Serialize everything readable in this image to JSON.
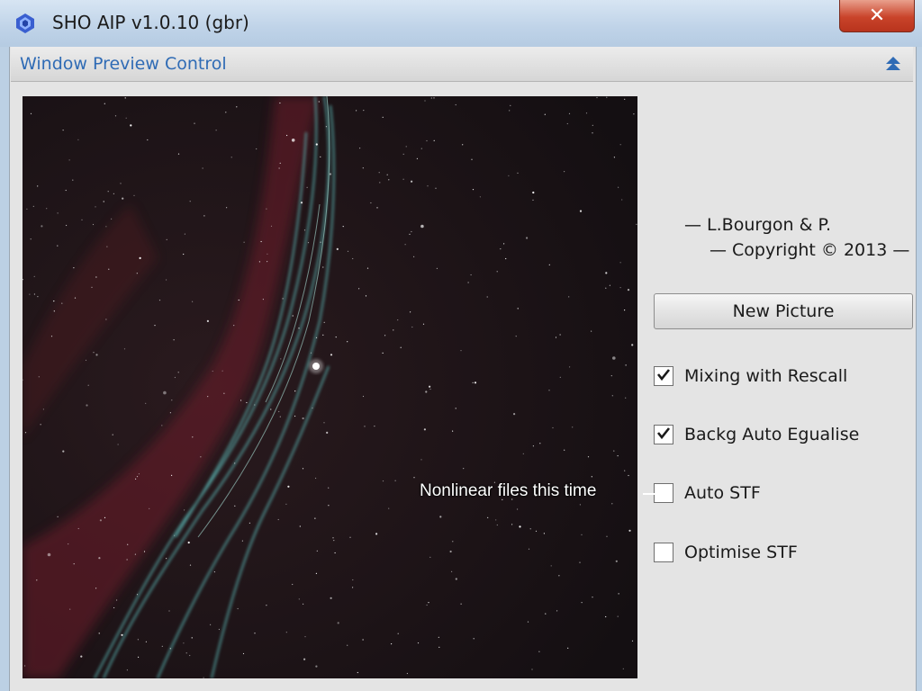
{
  "window": {
    "title": "SHO AIP v1.0.10 (gbr)",
    "close_label": "✕"
  },
  "section": {
    "title": "Window Preview Control"
  },
  "credits": {
    "line1": "— L.Bourgon & P.",
    "line2": "— Copyright © 2013 —"
  },
  "buttons": {
    "new_picture": "New Picture"
  },
  "options": [
    {
      "label": "Mixing with Rescall",
      "checked": true
    },
    {
      "label": "Backg Auto Egualise",
      "checked": true
    },
    {
      "label": "Auto STF",
      "checked": false
    },
    {
      "label": "Optimise STF",
      "checked": false
    }
  ],
  "annotation": {
    "text": "Nonlinear files this time"
  },
  "colors": {
    "accent": "#2f6bb5",
    "close_red": "#c9432a"
  }
}
